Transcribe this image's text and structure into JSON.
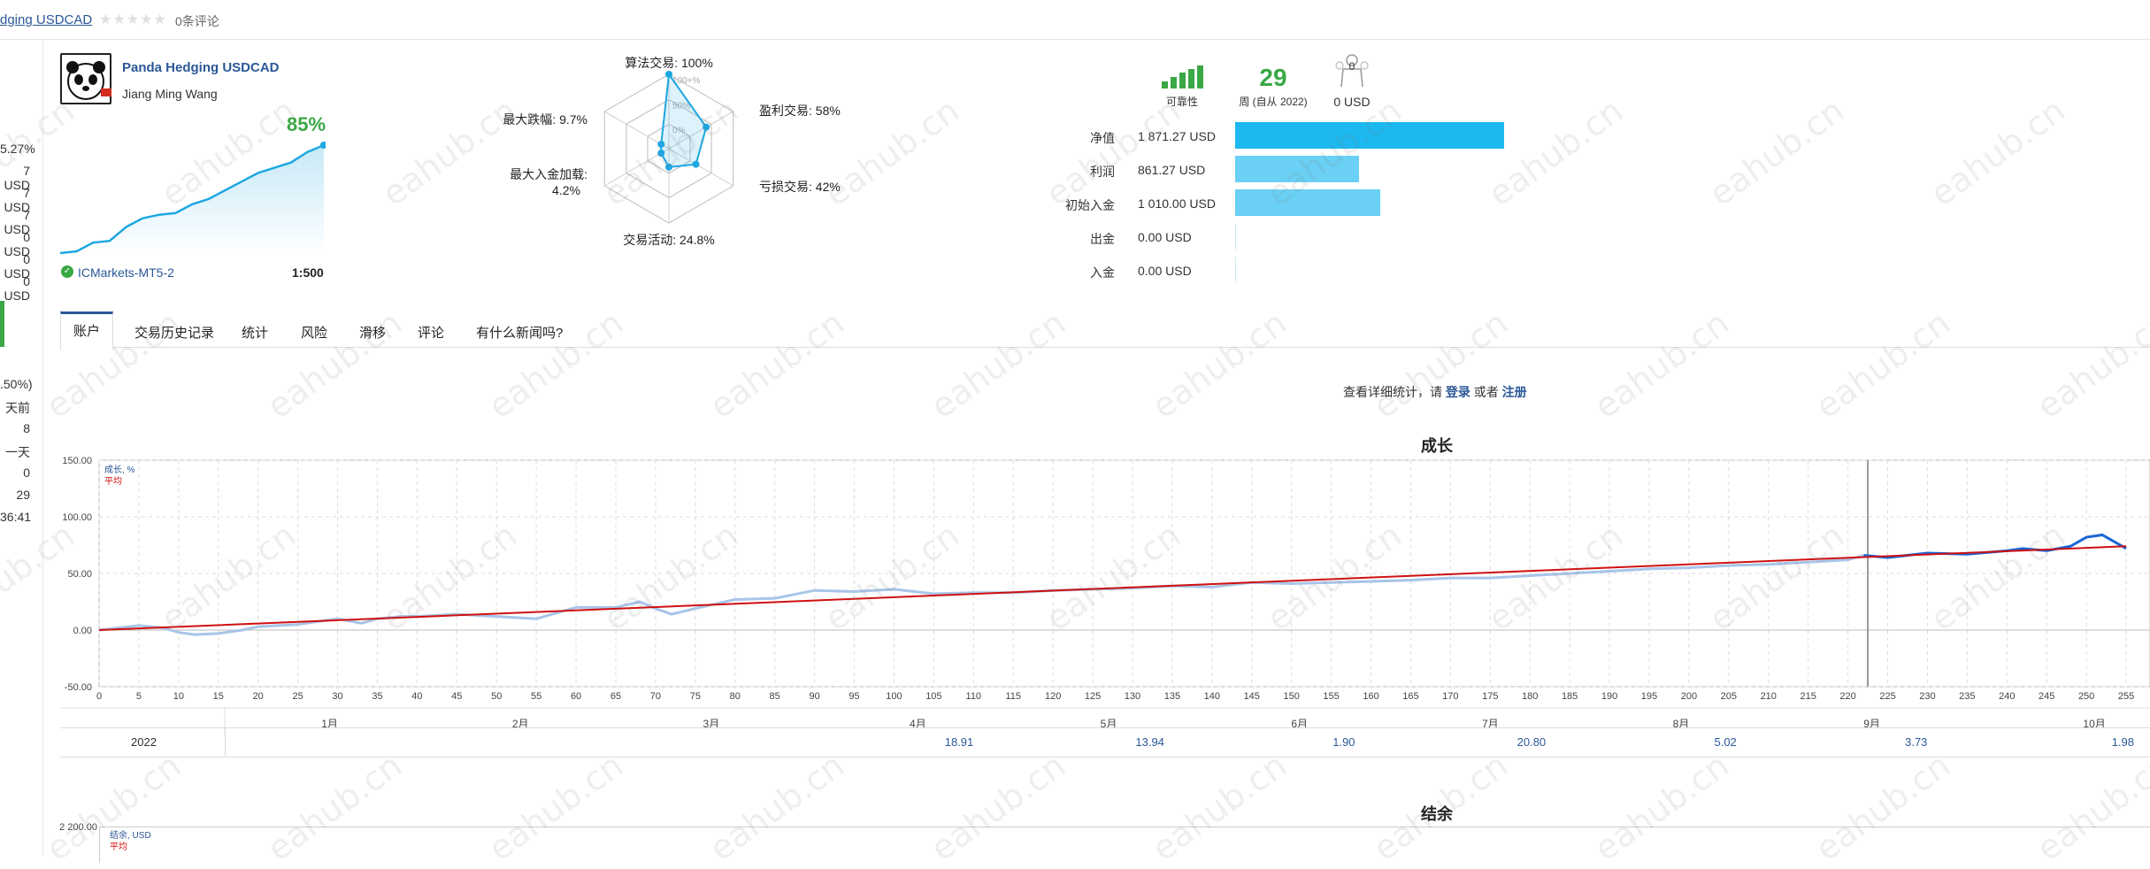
{
  "header": {
    "title": "dging USDCAD",
    "rating_stars": 5,
    "reviews": "0条评论"
  },
  "left_panel": {
    "values": [
      "5.27%",
      "7 USD",
      "7 USD",
      "7 USD",
      "0 USD",
      "0 USD",
      "0 USD"
    ],
    "values2": [
      ".50%)",
      "天前",
      "8",
      "一天",
      "0",
      "29",
      "36:41"
    ]
  },
  "signal": {
    "name": "Panda Hedging USDCAD",
    "author": "Jiang Ming Wang",
    "growth": "85%",
    "broker": "ICMarkets-MT5-2",
    "leverage": "1:500",
    "mini_chart": [
      0,
      1,
      6,
      7,
      15,
      20,
      22,
      23,
      28,
      31,
      36,
      41,
      46,
      49,
      52,
      58,
      62
    ]
  },
  "radar": {
    "axes": [
      {
        "label": "算法交易: 100%",
        "value": 100
      },
      {
        "label": "盈利交易: 58%",
        "value": 58
      },
      {
        "label": "亏损交易: 42%",
        "value": 42
      },
      {
        "label": "交易活动: 24.8%",
        "value": 24.8
      },
      {
        "label": "最大入金加载: 4.2%",
        "value": 4.2
      },
      {
        "label": "最大跌幅: 9.7%",
        "value": 9.7
      }
    ],
    "ticks": [
      "100+%",
      "50%",
      "0%"
    ]
  },
  "stats": {
    "reliability_label": "可靠性",
    "weeks": "29",
    "weeks_label": "周 (自从 2022)",
    "subscribers": "0",
    "subscribers_funds": "0 USD"
  },
  "bars": [
    {
      "label": "净值",
      "value": "1 871.27 USD",
      "amount": 1871.27
    },
    {
      "label": "利润",
      "value": "861.27 USD",
      "amount": 861.27
    },
    {
      "label": "初始入金",
      "value": "1 010.00 USD",
      "amount": 1010.0
    },
    {
      "label": "出金",
      "value": "0.00 USD",
      "amount": 0
    },
    {
      "label": "入金",
      "value": "0.00 USD",
      "amount": 0
    }
  ],
  "tabs": [
    "账户",
    "交易历史记录",
    "统计",
    "风险",
    "滑移",
    "评论",
    "有什么新闻吗?"
  ],
  "login_prompt": {
    "text": "查看详细统计，请",
    "login": "登录",
    "or": "或者",
    "register": "注册"
  },
  "watermark": "eahub.cn",
  "chart_data": [
    {
      "type": "line",
      "title": "成长",
      "legend": [
        "成长, %",
        "平均"
      ],
      "ylim": [
        -50,
        150
      ],
      "yticks": [
        "150.00",
        "100.00",
        "50.00",
        "0.00",
        "-50.00"
      ],
      "xticks": [
        0,
        5,
        10,
        15,
        20,
        25,
        30,
        35,
        40,
        45,
        50,
        55,
        60,
        65,
        70,
        75,
        80,
        85,
        90,
        95,
        100,
        105,
        110,
        115,
        120,
        125,
        130,
        135,
        140,
        145,
        150,
        155,
        160,
        165,
        170,
        175,
        180,
        185,
        190,
        195,
        200,
        205,
        210,
        215,
        220,
        225,
        230,
        235,
        240,
        245,
        250,
        255
      ],
      "months": [
        "1月",
        "2月",
        "3月",
        "4月",
        "5月",
        "6月",
        "7月",
        "8月",
        "9月",
        "10月"
      ],
      "series": [
        {
          "name": "成长, %",
          "x": [
            0,
            5,
            8,
            10,
            12,
            15,
            18,
            20,
            25,
            30,
            33,
            35,
            38,
            40,
            45,
            50,
            55,
            60,
            65,
            68,
            70,
            72,
            75,
            80,
            85,
            90,
            95,
            100,
            105,
            110,
            115,
            120,
            125,
            130,
            135,
            140,
            145,
            150,
            155,
            160,
            165,
            170,
            175,
            180,
            185,
            190,
            195,
            200,
            205,
            210,
            215,
            220,
            222,
            225,
            230,
            235,
            240,
            242,
            245,
            248,
            250,
            252,
            255
          ],
          "y": [
            0,
            4,
            2,
            -2,
            -4,
            -3,
            0,
            3,
            5,
            10,
            6,
            10,
            12,
            12,
            14,
            12,
            10,
            20,
            20,
            25,
            19,
            14,
            19,
            27,
            28,
            35,
            34,
            36,
            32,
            33,
            33,
            35,
            36,
            37,
            39,
            38,
            42,
            41,
            42,
            43,
            44,
            46,
            46,
            48,
            50,
            52,
            54,
            55,
            57,
            58,
            60,
            62,
            66,
            64,
            68,
            67,
            70,
            72,
            70,
            74,
            82,
            84,
            72
          ]
        },
        {
          "name": "平均",
          "x": [
            0,
            255
          ],
          "y": [
            0,
            74
          ]
        }
      ]
    },
    {
      "type": "line",
      "title": "结余",
      "legend": [
        "结余, USD",
        "平均"
      ],
      "yticks": [
        "2 200.00"
      ]
    }
  ],
  "monthly_table": {
    "year": "2022",
    "values": [
      "18.91",
      "13.94",
      "1.90",
      "20.80",
      "5.02",
      "3.73",
      "1.98"
    ]
  }
}
